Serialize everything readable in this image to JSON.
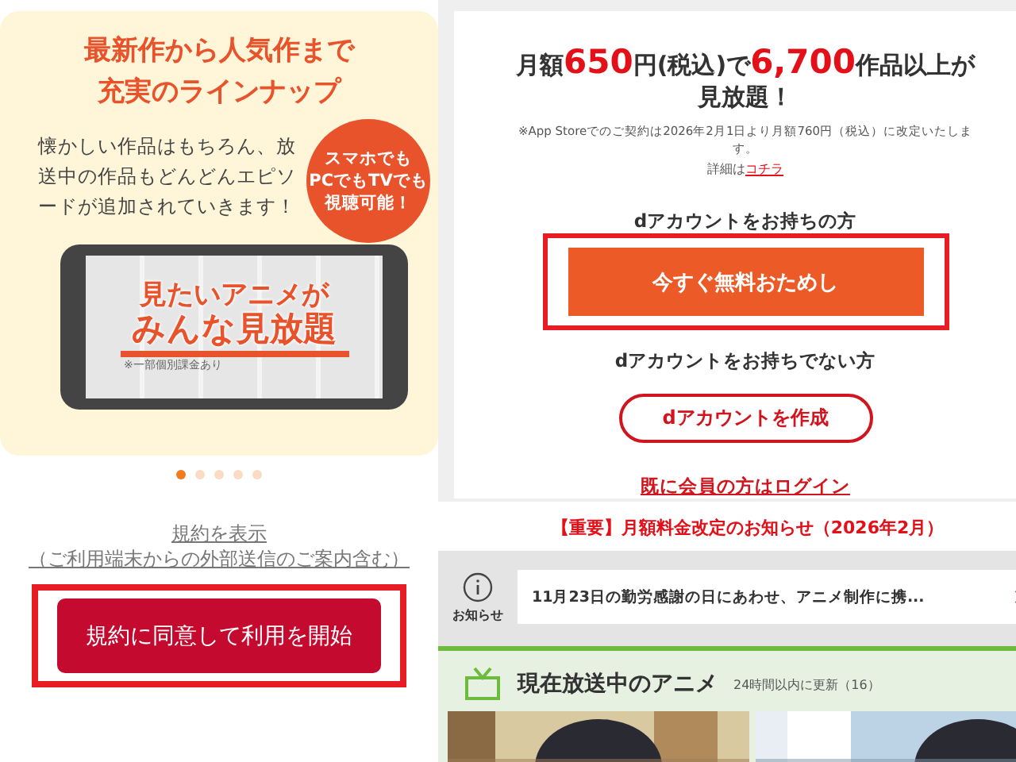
{
  "left": {
    "feature": {
      "title": [
        "最新作から人気作まで",
        "充実のラインナップ"
      ],
      "description": "懐かしい作品はもちろん、放送中の作品もどんどんエピソードが追加されていきます！",
      "bubble": [
        "スマホでも",
        "PCでもTVでも",
        "視聴可能！"
      ],
      "screen_lines": [
        "見たいアニメが",
        "みんな見放題"
      ],
      "screen_note": "※一部個別課金あり"
    },
    "carousel_dots": [
      {
        "selected": true
      },
      {
        "selected": false
      },
      {
        "selected": false
      },
      {
        "selected": false
      },
      {
        "selected": false
      }
    ],
    "terms_link": [
      "規約を表示",
      "（ご利用端末からの外部送信のご案内含む）"
    ],
    "start_button": {
      "label": "規約に同意して利用を開始",
      "highlighted": true
    }
  },
  "right": {
    "headline": "月額**650**円(税込)で**6,700**作品以上が見放題！",
    "note": "※App Storeでのご契約は2026年2月1日より月額760円（税込）に改定いたします。",
    "detail_prefix": "詳細は",
    "detail_link": "コチラ",
    "has_account_label": "dアカウントをお持ちの方",
    "trial_button": {
      "label": "今すぐ無料おためし",
      "highlighted": true
    },
    "no_account_label": "dアカウントをお持ちでない方",
    "create_button": {
      "label": "dアカウントを作成",
      "highlighted": false
    },
    "login_link": "既に会員の方はログイン",
    "important_notice": "【重要】月額料金改定のお知らせ（2026年2月）",
    "news": {
      "label": "お知らせ",
      "text": "11月23日の勤労感謝の日にあわせ、アニメ制作に携..."
    },
    "section": {
      "title": "現在放送中のアニメ",
      "subtitle": "24時間以内に更新（16）"
    }
  }
}
